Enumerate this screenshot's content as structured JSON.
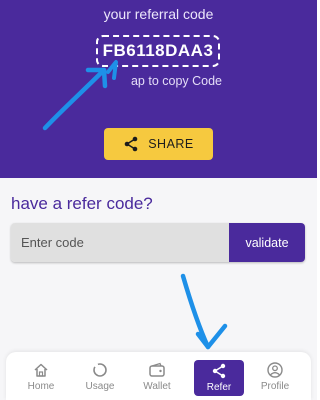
{
  "referral": {
    "label": "your referral code",
    "code": "FB6118DAA3",
    "tap_hint": "ap to copy Code",
    "share_label": "SHARE"
  },
  "refer_code": {
    "title": "have a refer code?",
    "placeholder": "Enter code",
    "validate_label": "validate"
  },
  "nav": {
    "items": [
      {
        "label": "Home",
        "icon": "home-icon"
      },
      {
        "label": "Usage",
        "icon": "usage-icon"
      },
      {
        "label": "Wallet",
        "icon": "wallet-icon"
      },
      {
        "label": "Refer",
        "icon": "share-icon"
      },
      {
        "label": "Profile",
        "icon": "profile-icon"
      }
    ],
    "active": "Refer"
  },
  "colors": {
    "primary": "#4a2a9c",
    "accent": "#f6c93f",
    "annotation": "#1e90e8"
  }
}
